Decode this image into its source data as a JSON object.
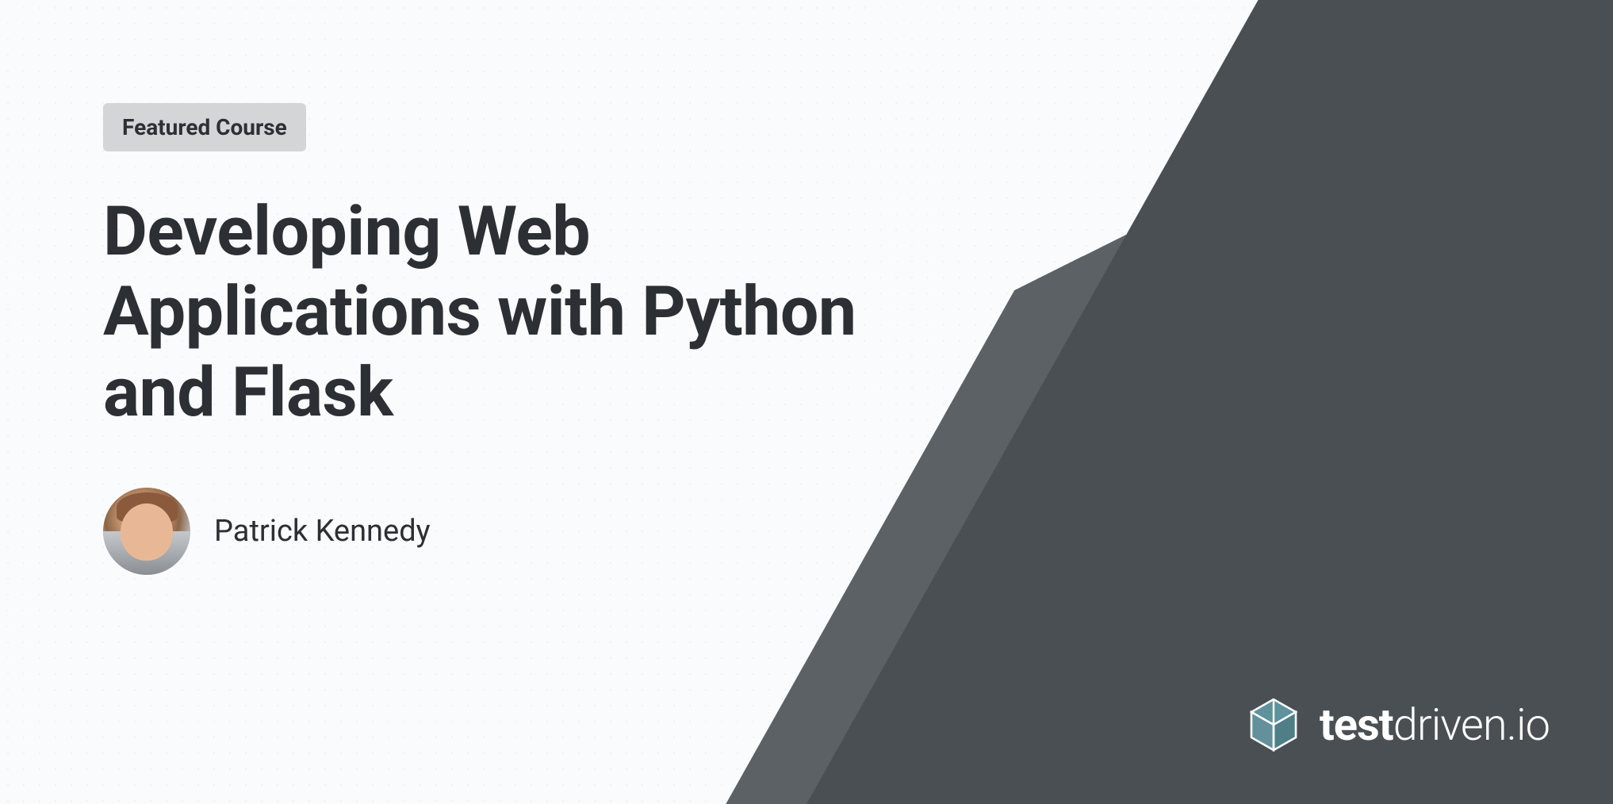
{
  "badge": "Featured Course",
  "title": "Developing Web Applications with Python and Flask",
  "author": {
    "name": "Patrick Kennedy"
  },
  "brand": {
    "name_bold": "test",
    "name_light": "driven.io"
  },
  "colors": {
    "text_primary": "#2c2f33",
    "bg_dark": "#4a4f54",
    "bg_dark_accent": "#5c6166",
    "badge_bg": "#d4d5d7",
    "logo_accent": "#6bb6c4"
  }
}
